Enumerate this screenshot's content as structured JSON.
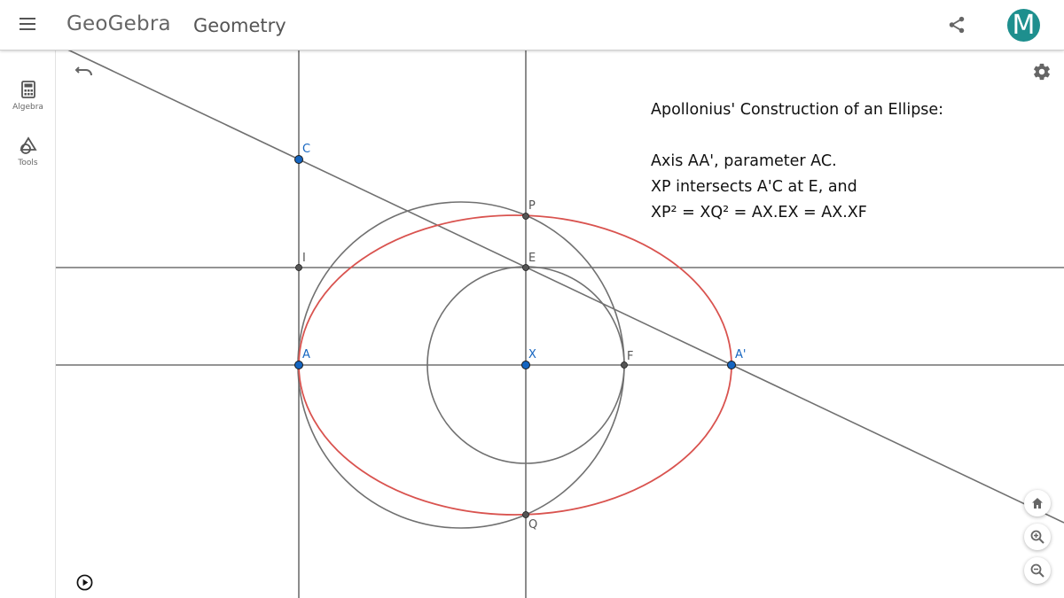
{
  "header": {
    "logo": "GeoGebra",
    "title": "Geometry",
    "avatar_letter": "M",
    "avatar_color": "#1e8f8e"
  },
  "sidebar": {
    "items": [
      {
        "label": "Algebra",
        "icon": "calculator-icon"
      },
      {
        "label": "Tools",
        "icon": "shapes-icon"
      }
    ]
  },
  "graphics": {
    "text_lines": [
      "Apollonius' Construction of an Ellipse:",
      "",
      "Axis AA', parameter AC.",
      "XP intersects A'C at E, and",
      "XP² = XQ² = AX.EX = AX.XF"
    ],
    "points": {
      "A": "A",
      "A_prime": "A'",
      "X": "X",
      "C": "C",
      "P": "P",
      "E": "E",
      "F": "F",
      "I": "I",
      "Q": "Q"
    },
    "colors": {
      "ellipse": "#d9534f",
      "free_point": "#1565c0",
      "dependent_point": "#555555",
      "line": "#707070"
    }
  },
  "controls": {
    "undo_icon": "undo-icon",
    "settings_icon": "gear-icon",
    "play_icon": "play-icon",
    "home_icon": "home-icon",
    "zoom_in_icon": "zoom-in-icon",
    "zoom_out_icon": "zoom-out-icon"
  }
}
